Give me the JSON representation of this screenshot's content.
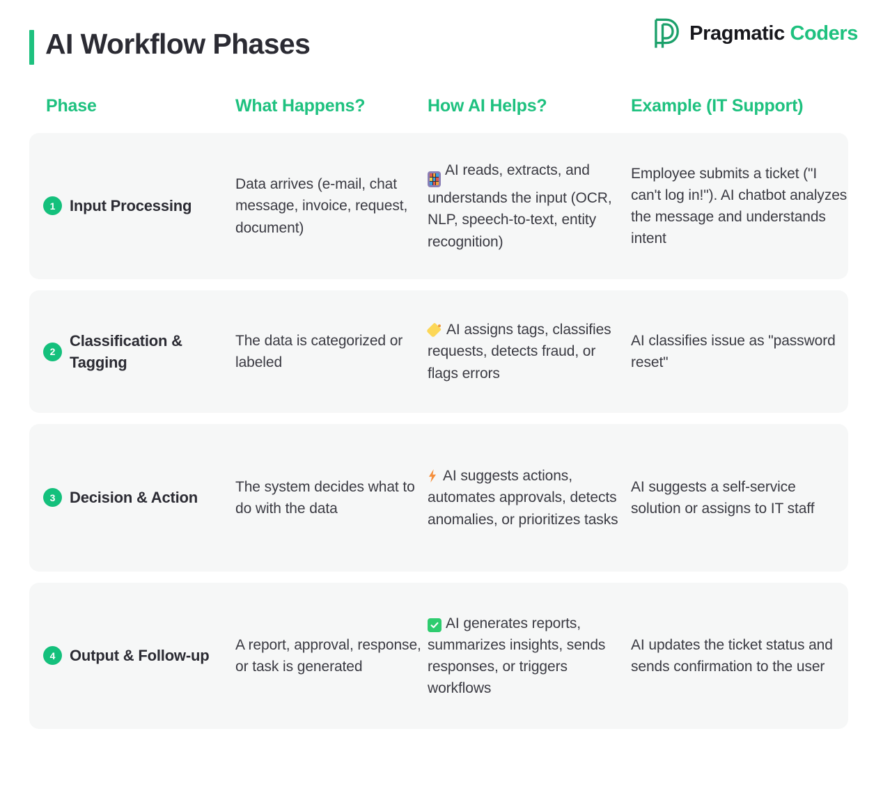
{
  "header": {
    "title": "AI Workflow Phases",
    "accent_color": "#1ec17f",
    "logo": {
      "mark_name": "pragmatic-coders-p-mark",
      "word_primary": "Pragmatic",
      "word_secondary": "Coders",
      "primary_color": "#17171c",
      "secondary_color": "#1ec17f"
    }
  },
  "table": {
    "columns": [
      {
        "label": "Phase"
      },
      {
        "label": "What Happens?"
      },
      {
        "label": "How AI Helps?"
      },
      {
        "label": "Example (IT Support)"
      }
    ],
    "rows": [
      {
        "number": "1",
        "phase": "Input Processing",
        "what_happens": "Data arrives (e-mail, chat message, invoice, request, document)",
        "how_ai_helps_icon": "input-numbers-emoji",
        "how_ai_helps": "AI reads, extracts, and understands the input (OCR, NLP, speech-to-text, entity recognition)",
        "example": "Employee submits a ticket (\"I can't log in!\"). AI chatbot analyzes the message and understands intent"
      },
      {
        "number": "2",
        "phase": "Classification & Tagging",
        "what_happens": "The data is categorized or labeled",
        "how_ai_helps_icon": "tag-emoji",
        "how_ai_helps": "AI assigns tags, classifies requests, detects fraud, or flags errors",
        "example": "AI classifies issue as \"password reset\""
      },
      {
        "number": "3",
        "phase": "Decision & Action",
        "what_happens": "The system decides what to do with the data",
        "how_ai_helps_icon": "high-voltage-emoji",
        "how_ai_helps": "AI suggests actions, automates approvals, detects anomalies, or prioritizes tasks",
        "example": "AI suggests a self-service solution or assigns to IT staff"
      },
      {
        "number": "4",
        "phase": "Output & Follow-up",
        "what_happens": "A report, approval, response, or task is generated",
        "how_ai_helps_icon": "check-box-emoji",
        "how_ai_helps": "AI generates reports, summarizes insights, sends responses, or triggers workflows",
        "example": "AI updates the ticket status and sends confirmation to the user"
      }
    ]
  }
}
